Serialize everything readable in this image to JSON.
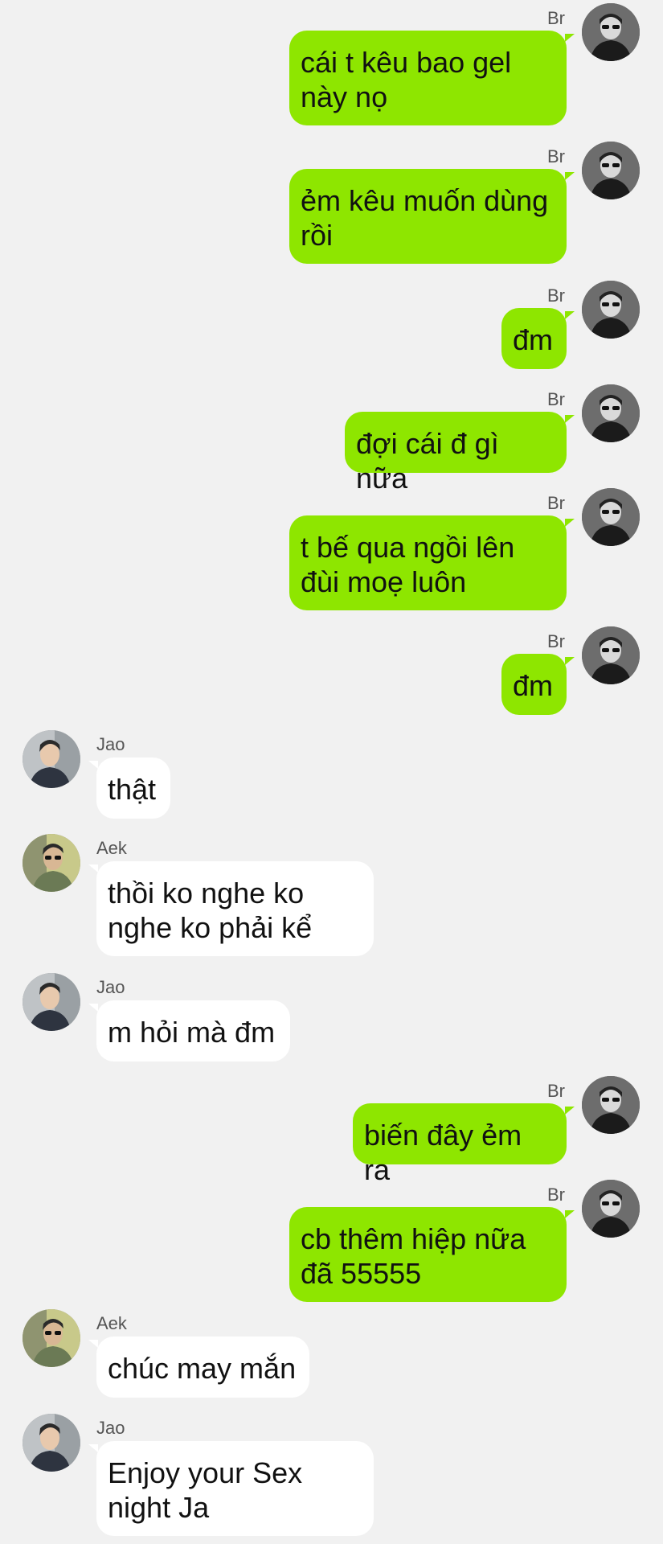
{
  "colors": {
    "background": "#f1f1f1",
    "outgoing_bubble": "#8ee600",
    "incoming_bubble": "#ffffff",
    "text": "#111111",
    "name_text": "#555555"
  },
  "messages": [
    {
      "sender": "Br",
      "direction": "outgoing",
      "avatar": "avatar-br",
      "text": "cái t kêu bao gel\nnày nọ"
    },
    {
      "sender": "Br",
      "direction": "outgoing",
      "avatar": "avatar-br",
      "text": "ẻm kêu muốn dùng\nrồi"
    },
    {
      "sender": "Br",
      "direction": "outgoing",
      "avatar": "avatar-br",
      "text": "đm"
    },
    {
      "sender": "Br",
      "direction": "outgoing",
      "avatar": "avatar-br",
      "text": "đợi cái đ gì nữa"
    },
    {
      "sender": "Br",
      "direction": "outgoing",
      "avatar": "avatar-br",
      "text": "t bế qua ngồi lên\nđùi moẹ luôn"
    },
    {
      "sender": "Br",
      "direction": "outgoing",
      "avatar": "avatar-br",
      "text": "đm"
    },
    {
      "sender": "Jao",
      "direction": "incoming",
      "avatar": "avatar-jao",
      "text": "thật"
    },
    {
      "sender": "Aek",
      "direction": "incoming",
      "avatar": "avatar-aek",
      "text": "thồi ko nghe ko\nnghe ko phải kể"
    },
    {
      "sender": "Jao",
      "direction": "incoming",
      "avatar": "avatar-jao",
      "text": "m hỏi mà đm"
    },
    {
      "sender": "Br",
      "direction": "outgoing",
      "avatar": "avatar-br",
      "text": "biến đây ẻm ra"
    },
    {
      "sender": "Br",
      "direction": "outgoing",
      "avatar": "avatar-br",
      "text": "cb thêm hiệp nữa\nđã 55555"
    },
    {
      "sender": "Aek",
      "direction": "incoming",
      "avatar": "avatar-aek",
      "text": "chúc may mắn"
    },
    {
      "sender": "Jao",
      "direction": "incoming",
      "avatar": "avatar-jao",
      "text": "Enjoy your Sex\nnight Ja"
    }
  ]
}
